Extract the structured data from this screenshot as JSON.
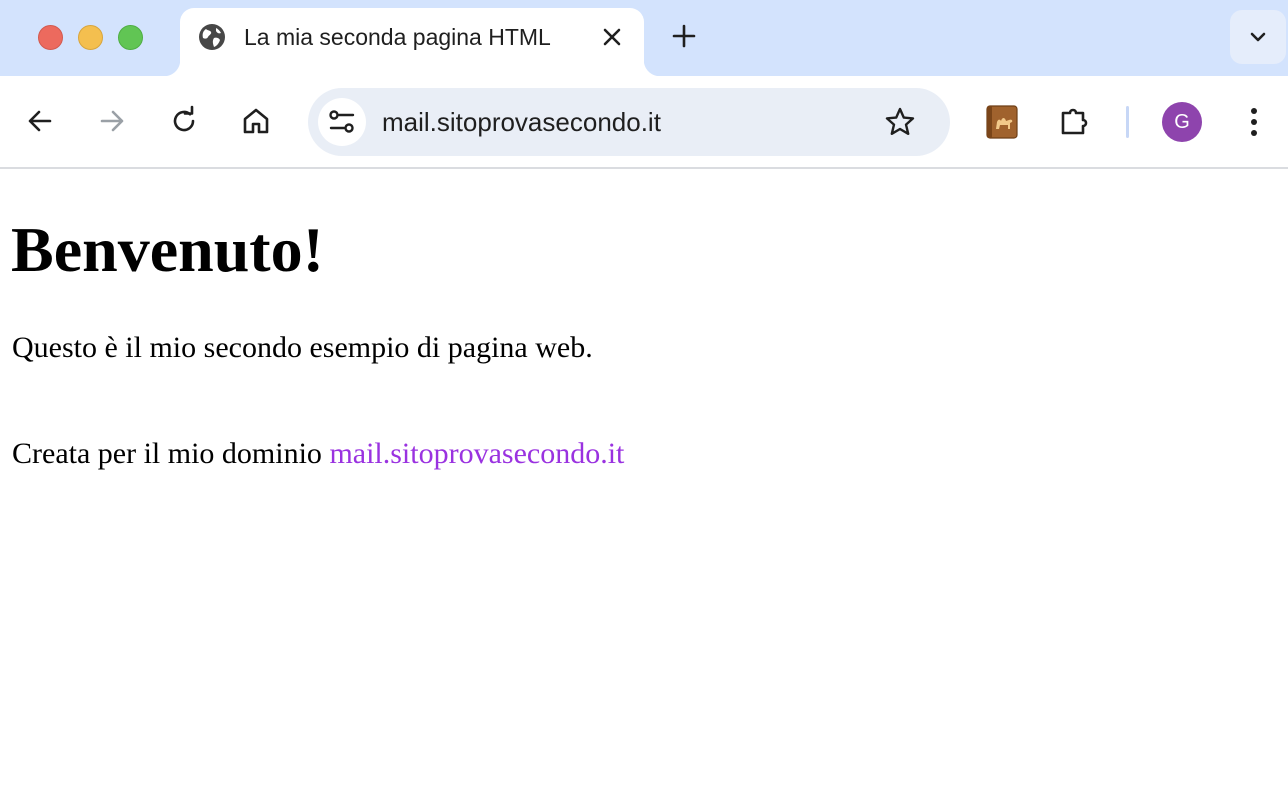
{
  "window": {
    "controls": [
      "close",
      "minimize",
      "zoom"
    ]
  },
  "tabs": [
    {
      "title": "La mia seconda pagina HTML",
      "favicon": "globe-icon",
      "active": true
    }
  ],
  "toolbar": {
    "back_icon": "arrow-left-icon",
    "forward_icon": "arrow-right-icon",
    "reload_icon": "reload-icon",
    "home_icon": "home-icon",
    "url": "mail.sitoprovasecondo.it",
    "bookmark_icon": "star-icon",
    "extensions": [
      "camel-book-icon",
      "puzzle-icon"
    ],
    "profile_initial": "G",
    "profile_color": "#8e44ad",
    "menu_icon": "kebab-menu-icon"
  },
  "page": {
    "heading": "Benvenuto!",
    "paragraph1": "Questo è il mio secondo esempio di pagina web.",
    "paragraph2_prefix": "Creata per il mio dominio ",
    "paragraph2_link": "mail.sitoprovasecondo.it",
    "link_color": "#9a32e0"
  },
  "colors": {
    "tabstrip_bg": "#d3e3fd",
    "omnibox_bg": "#e9eef6",
    "traffic_red": "#ec6a5e",
    "traffic_yellow": "#f4bf4f",
    "traffic_green": "#61c554"
  }
}
